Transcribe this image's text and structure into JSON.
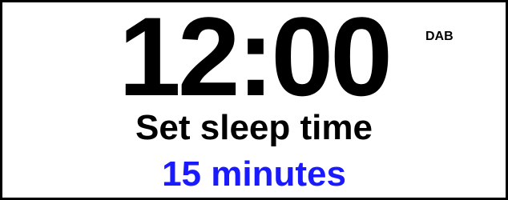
{
  "display": {
    "time": "12:00",
    "source": "DAB",
    "prompt": "Set sleep time",
    "value": "15 minutes"
  },
  "colors": {
    "text": "#000000",
    "value": "#1a1aff",
    "background": "#ffffff"
  }
}
